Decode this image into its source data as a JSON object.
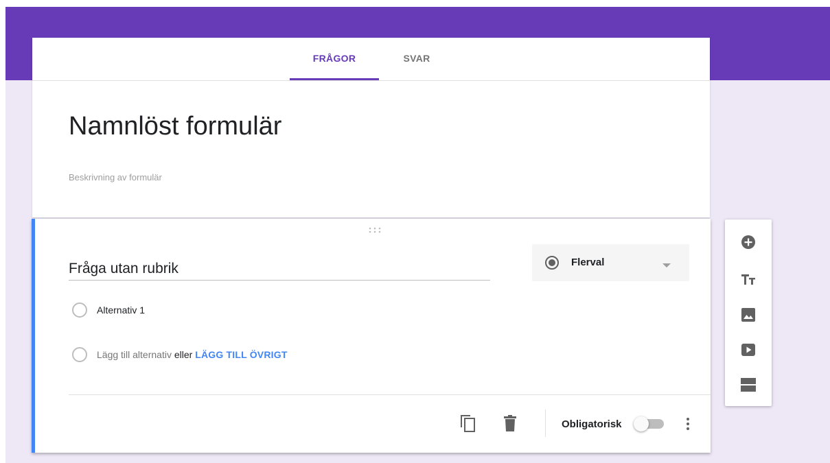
{
  "tabs": [
    {
      "label": "FRÅGOR",
      "active": true
    },
    {
      "label": "SVAR",
      "active": false
    }
  ],
  "form": {
    "title": "Namnlöst formulär",
    "description_placeholder": "Beskrivning av formulär"
  },
  "question": {
    "title": "Fråga utan rubrik",
    "type": "Flerval",
    "options": [
      {
        "label": "Alternativ 1"
      }
    ],
    "add_option": "Lägg till alternativ",
    "or": "eller",
    "add_other": "LÄGG TILL ÖVRIGT",
    "required_label": "Obligatorisk",
    "required": false
  },
  "icons": {
    "drag": "drag-handle-icon",
    "type": "radio-button-checked-icon",
    "caret": "caret-down-icon",
    "duplicate": "copy-icon",
    "delete": "trash-icon",
    "more": "more-vertical-icon"
  },
  "toolbar": [
    {
      "name": "add-question",
      "icon": "plus-circle-icon"
    },
    {
      "name": "add-title",
      "icon": "title-text-icon"
    },
    {
      "name": "add-image",
      "icon": "image-icon"
    },
    {
      "name": "add-video",
      "icon": "video-icon"
    },
    {
      "name": "add-section",
      "icon": "section-icon"
    }
  ],
  "colors": {
    "header": "#673ab7",
    "page_background": "#ede7f6",
    "accent": "#673ab7",
    "active_card_border": "#4285f4",
    "link": "#4285f4"
  }
}
